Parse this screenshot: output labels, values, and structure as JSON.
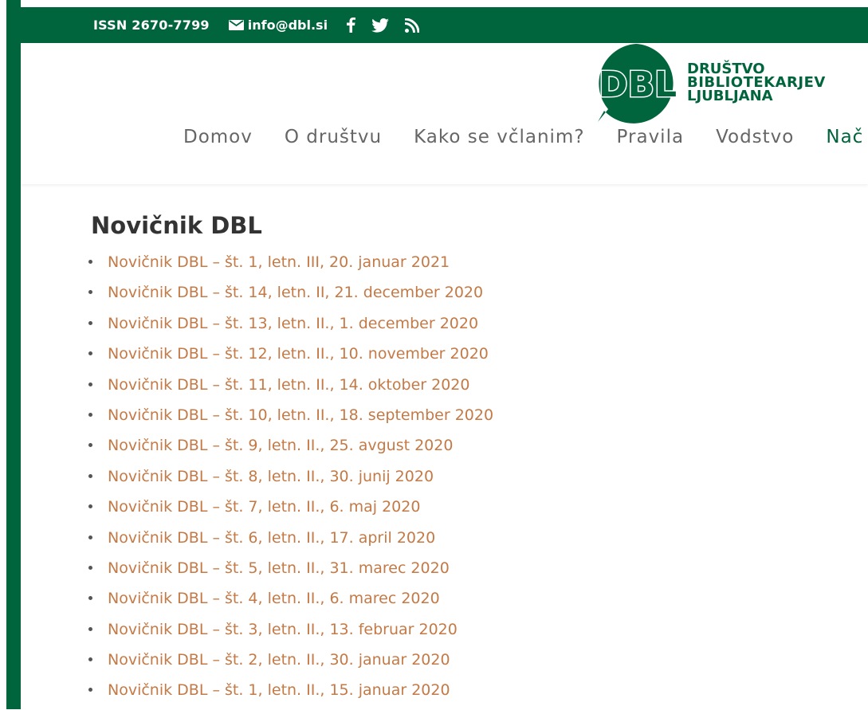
{
  "topbar": {
    "issn": "ISSN 2670-7799",
    "email": "info@dbl.si",
    "social": [
      "facebook-icon",
      "twitter-icon",
      "rss-icon"
    ]
  },
  "logo": {
    "mark": "DBL",
    "line1": "DRUŠTVO",
    "line2": "BIBLIOTEKARJEV",
    "line3": "LJUBLJANA"
  },
  "nav": {
    "items": [
      "Domov",
      "O društvu",
      "Kako se včlanim?",
      "Pravila",
      "Vodstvo",
      "Nač"
    ]
  },
  "page": {
    "title": "Novičnik DBL",
    "newsletters": [
      "Novičnik DBL – št. 1, letn. III, 20. januar 2021",
      "Novičnik DBL – št. 14, letn. II, 21. december 2020",
      "Novičnik DBL – št. 13, letn. II., 1. december 2020",
      "Novičnik DBL – št. 12, letn. II., 10. november 2020",
      "Novičnik DBL – št. 11, letn. II., 14. oktober 2020",
      "Novičnik DBL – št. 10, letn. II., 18. september 2020",
      "Novičnik DBL – št. 9, letn. II., 25. avgust 2020",
      "Novičnik DBL – št. 8, letn. II., 30. junij 2020",
      "Novičnik DBL – št. 7, letn. II., 6. maj 2020",
      "Novičnik DBL – št. 6, letn. II., 17. april 2020",
      "Novičnik DBL – št. 5, letn. II., 31. marec 2020",
      "Novičnik DBL – št. 4, letn. II., 6. marec 2020",
      "Novičnik DBL – št. 3, letn. II., 13. februar 2020",
      "Novičnik DBL – št. 2, letn. II., 30. januar 2020",
      "Novičnik DBL – št. 1, letn. II., 15. januar 2020"
    ]
  },
  "colors": {
    "brand_green": "#00653d",
    "link": "#c47a46",
    "nav_text": "#666666"
  }
}
